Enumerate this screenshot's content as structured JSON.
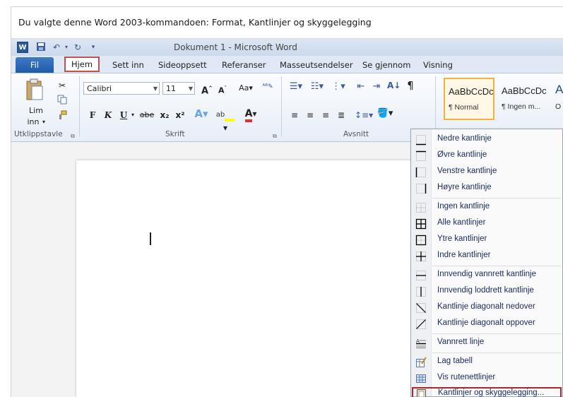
{
  "banner": {
    "text": "Du valgte denne Word 2003-kommandoen:  Format, Kantlinjer og skyggelegging"
  },
  "titlebar": {
    "app_icon": "W",
    "title": "Dokument 1  -  Microsoft Word",
    "undo_icon": "undo-icon",
    "redo_icon": "redo-icon",
    "save_icon": "save-icon"
  },
  "tabs": [
    {
      "label": "Fil"
    },
    {
      "label": "Hjem"
    },
    {
      "label": "Sett inn"
    },
    {
      "label": "Sideoppsett"
    },
    {
      "label": "Referanser"
    },
    {
      "label": "Masseutsendelser"
    },
    {
      "label": "Se gjennom"
    },
    {
      "label": "Visning"
    }
  ],
  "ribbon": {
    "clipboard": {
      "paste_label_1": "Lim",
      "paste_label_2": "inn",
      "group": "Utklippstavle"
    },
    "font": {
      "name": "Calibri",
      "size": "11",
      "bold": "F",
      "italic": "K",
      "underline": "U",
      "strike": "abe",
      "subscript": "x₂",
      "superscript": "x²",
      "group": "Skrift"
    },
    "paragraph": {
      "group": "Avsnitt"
    },
    "styles": [
      {
        "sample": "AaBbCcDc",
        "name": "¶ Normal"
      },
      {
        "sample": "AaBbCcDc",
        "name": "¶ Ingen m..."
      },
      {
        "sample": "A",
        "name": "O"
      }
    ]
  },
  "menu": {
    "items": [
      {
        "label": "Nedre kantlinje",
        "icon": "bottom-border-icon"
      },
      {
        "label": "Øvre kantlinje",
        "icon": "top-border-icon"
      },
      {
        "label": "Venstre kantlinje",
        "icon": "left-border-icon"
      },
      {
        "label": "Høyre kantlinje",
        "icon": "right-border-icon"
      },
      {
        "label": "Ingen kantlinje",
        "icon": "no-border-icon"
      },
      {
        "label": "Alle kantlinjer",
        "icon": "all-borders-icon"
      },
      {
        "label": "Ytre kantlinjer",
        "icon": "outside-borders-icon"
      },
      {
        "label": "Indre kantlinjer",
        "icon": "inside-borders-icon"
      },
      {
        "label": "Innvendig vannrett kantlinje",
        "icon": "inside-horizontal-border-icon"
      },
      {
        "label": "Innvendig loddrett kantlinje",
        "icon": "inside-vertical-border-icon"
      },
      {
        "label": "Kantlinje diagonalt nedover",
        "icon": "diagonal-down-border-icon"
      },
      {
        "label": "Kantlinje diagonalt oppover",
        "icon": "diagonal-up-border-icon"
      },
      {
        "label": "Vannrett linje",
        "icon": "horizontal-line-icon"
      },
      {
        "label": "Lag tabell",
        "icon": "draw-table-icon"
      },
      {
        "label": "Vis rutenettlinjer",
        "icon": "view-gridlines-icon"
      },
      {
        "label": "Kantlinjer og skyggelegging...",
        "icon": "borders-shading-icon"
      }
    ]
  },
  "colors": {
    "highlight": "#c0504d",
    "tab_fil": "#2b63b3",
    "menu_text": "#1a2a5c"
  }
}
